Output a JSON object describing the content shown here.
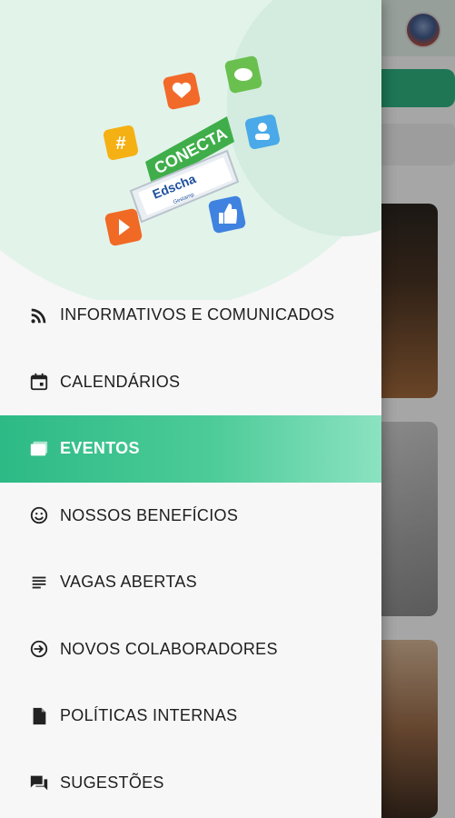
{
  "logo": {
    "title": "CONECTA",
    "brand": "Edscha",
    "brand_sub": "Gestamp"
  },
  "menu": {
    "items": [
      {
        "label": "INFORMATIVOS E COMUNICADOS",
        "icon": "rss-icon"
      },
      {
        "label": "CALENDÁRIOS",
        "icon": "calendar-icon"
      },
      {
        "label": "EVENTOS",
        "icon": "photos-icon",
        "active": true
      },
      {
        "label": "NOSSOS BENEFÍCIOS",
        "icon": "smiley-icon"
      },
      {
        "label": "VAGAS ABERTAS",
        "icon": "list-icon"
      },
      {
        "label": "NOVOS COLABORADORES",
        "icon": "login-icon"
      },
      {
        "label": "POLÍTICAS INTERNAS",
        "icon": "document-icon"
      },
      {
        "label": "SUGESTÕES",
        "icon": "chat-icon"
      }
    ]
  },
  "colors": {
    "accent": "#2dba85",
    "accent_light": "#8be2c1",
    "hero_bg": "#e2f3ea"
  }
}
